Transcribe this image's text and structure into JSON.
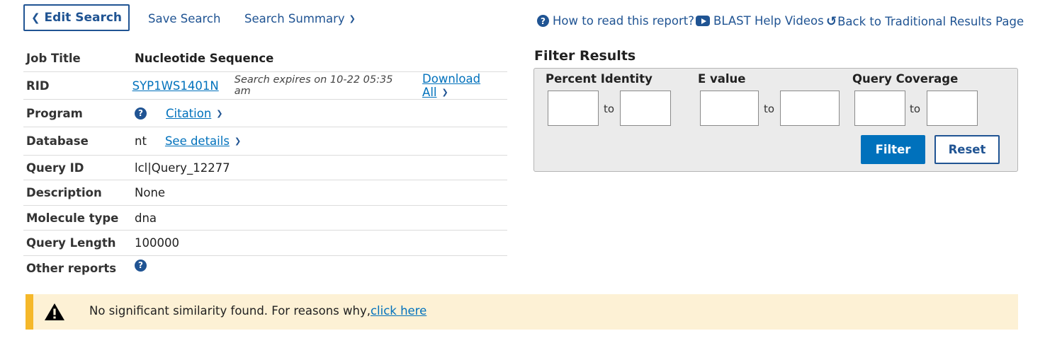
{
  "toolbar": {
    "edit_search": "Edit Search",
    "save_search": "Save Search",
    "search_summary": "Search Summary",
    "how_to_read": "How to read this report?",
    "help_videos": "BLAST Help Videos",
    "back_traditional": "Back to Traditional Results Page"
  },
  "info": {
    "job_title": {
      "label": "Job Title",
      "value": "Nucleotide Sequence"
    },
    "rid": {
      "label": "RID",
      "value": "SYP1WS1401N",
      "expires": "Search expires on 10-22 05:35 am",
      "download": "Download All"
    },
    "program": {
      "label": "Program",
      "citation": "Citation"
    },
    "database": {
      "label": "Database",
      "value": "nt",
      "details": "See details"
    },
    "query_id": {
      "label": "Query ID",
      "value": "lcl|Query_12277"
    },
    "description": {
      "label": "Description",
      "value": "None"
    },
    "molecule_type": {
      "label": "Molecule type",
      "value": "dna"
    },
    "query_length": {
      "label": "Query Length",
      "value": "100000"
    },
    "other_reports": {
      "label": "Other reports"
    }
  },
  "filter": {
    "title": "Filter Results",
    "percent_identity": "Percent Identity",
    "evalue": "E value",
    "query_coverage": "Query Coverage",
    "to": "to",
    "filter_button": "Filter",
    "reset_button": "Reset"
  },
  "warning": {
    "text": "No significant similarity found. For reasons why,",
    "link": "click here"
  },
  "colors": {
    "primary": "#0071bc",
    "dark_blue": "#205493",
    "warning_bg": "#fdf1d5",
    "warning_bar": "#f5b82a"
  }
}
